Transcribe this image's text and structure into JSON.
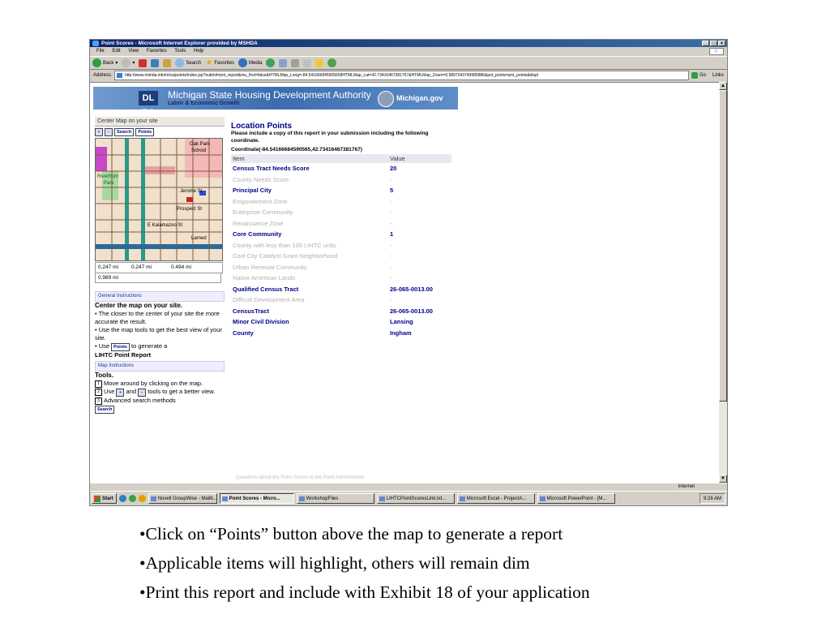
{
  "window": {
    "title": "Point Scores - Microsoft Internet Explorer provided by MSHDA",
    "buttons": [
      "_",
      "□",
      "×"
    ]
  },
  "menu": [
    "File",
    "Edit",
    "View",
    "Favorites",
    "Tools",
    "Help"
  ],
  "toolbar": {
    "back": "Back",
    "search": "Search",
    "favorites": "Favorites",
    "media": "Media"
  },
  "address": {
    "label": "Address",
    "url": "http://www.mshda.info/mlca/points/index.jsp?submit=pnt_report&mu_first=false&HTMLMap_Long=-84.541666845905658HTMLMap_Lat=42.73416467381767&HTMLMap_Zoom=0.9897343749985886&pnt_points=pnt_points&displ",
    "go": "Go",
    "links": "Links"
  },
  "banner": {
    "logo": "DL EG",
    "title": "Michigan State Housing Development Authority",
    "subtitle": "Labor & Economic Growth",
    "michigan": "Michigan.gov"
  },
  "left": {
    "center_header": "Center Map on your site",
    "search_btn": "Search",
    "points_btn": "Points",
    "map_labels": [
      "Oak Park",
      "School",
      "Jerome St",
      "Prospect St",
      "E Kalamazoo St",
      "Larned",
      "Riverfront",
      "Park"
    ],
    "scale": [
      "0.247 mi",
      "0.247 mi",
      "0.494 mi"
    ],
    "scale_total": "0.989 mi",
    "gi_header": "General Instructions",
    "gi_title": "Center the map on your site.",
    "gi_1": "• The closer to the center of your site the more accurate the result.",
    "gi_2": "• Use the map tools to get the best view of your site.",
    "gi_3a": "• Use",
    "gi_3b": "to generate a",
    "gi_3c": "LIHTC Point Report",
    "mi_header": "Map Instructions",
    "mi_title": "Tools.",
    "mi_1": "Move around by clicking on the map.",
    "mi_2a": "Use",
    "mi_2b": "and",
    "mi_2c": "tools to get a better view.",
    "mi_3": "Advanced search methods"
  },
  "report": {
    "title": "Location Points",
    "note": "Please include a copy of this report in your submission including the following coordinate.",
    "coordinate": "Coordinate(-84.54166684590565,42.73416467381767)",
    "col_item": "Item",
    "col_value": "Value",
    "rows": [
      {
        "item": "Census Tract Needs Score",
        "value": "20",
        "hi": true
      },
      {
        "item": "County Needs Score",
        "value": "-",
        "hi": false
      },
      {
        "item": "Principal City",
        "value": "5",
        "hi": true
      },
      {
        "item": "Empowerment Zone",
        "value": "-",
        "hi": false
      },
      {
        "item": "Enterprise Community",
        "value": "-",
        "hi": false
      },
      {
        "item": "Renaissance Zone",
        "value": "-",
        "hi": false
      },
      {
        "item": "Core Community",
        "value": "1",
        "hi": true
      },
      {
        "item": "County with less than 100 LIHTC units",
        "value": "-",
        "hi": false
      },
      {
        "item": "Cool City Catalyst Grant Neighborhood",
        "value": "-",
        "hi": false
      },
      {
        "item": "Urban Renewal Community",
        "value": "-",
        "hi": false
      },
      {
        "item": "Native American Lands",
        "value": "-",
        "hi": false
      },
      {
        "item": "Qualified Census Tract",
        "value": "26-065-0013.00",
        "hi": true
      },
      {
        "item": "Difficult Development Area",
        "value": "-",
        "hi": false
      },
      {
        "item": "CensusTract",
        "value": "26-065-0013.00",
        "hi": true
      },
      {
        "item": "Minor Civil Division",
        "value": "Lansing",
        "hi": true
      },
      {
        "item": "County",
        "value": "Ingham",
        "hi": true
      }
    ],
    "footer_link": "Questions about the Point Scores to the Point Administrator"
  },
  "status": {
    "zone": "Internet"
  },
  "taskbar": {
    "start": "Start",
    "tasks": [
      {
        "label": "Novell GroupWise - Mailb...",
        "active": false
      },
      {
        "label": "Point Scores - Micro...",
        "active": true
      },
      {
        "label": "WorkshopFiles",
        "active": false
      },
      {
        "label": "LIHTCPointScoresLink.txt...",
        "active": false
      },
      {
        "label": "Microsoft Excel - ProjectA...",
        "active": false
      },
      {
        "label": "Microsoft PowerPoint - [M...",
        "active": false
      }
    ],
    "time": "9:26 AM"
  },
  "slide_bullets": [
    "•Click on “Points” button above the map to generate a report",
    "•Applicable items will highlight, others will remain dim",
    "•Print this report and include with Exhibit 18 of your application"
  ],
  "colors": {
    "title_bar": "#0a246a",
    "highlight_text": "#00008b",
    "dim_text": "#b0b0b0"
  }
}
